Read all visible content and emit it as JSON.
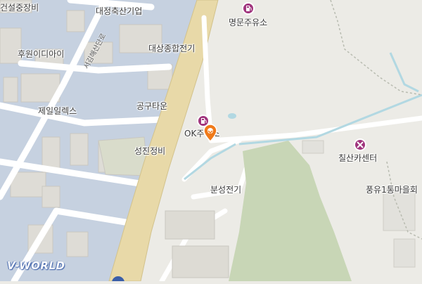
{
  "map": {
    "provider_logo": "V-WORLD",
    "colors": {
      "land": "#ecebe6",
      "industrial": "#c6d1e0",
      "building": "#e4e4e0",
      "main_road": "#e8d9a8",
      "road": "#ffffff",
      "park": "#c8d6b6",
      "stream": "#b2d8e2",
      "poi": "#a0347d",
      "marker": "#f07a1a"
    },
    "labels": [
      {
        "id": "daejeong",
        "text": "대정축산기업"
      },
      {
        "id": "daesang",
        "text": "대상종합전기"
      },
      {
        "id": "geonseol",
        "text": "건설중장비"
      },
      {
        "id": "huwon",
        "text": "후원이디아이"
      },
      {
        "id": "jeil",
        "text": "제일일렉스"
      },
      {
        "id": "gonggu",
        "text": "공구타운"
      },
      {
        "id": "seongjin",
        "text": "성진정비"
      },
      {
        "id": "bunseong",
        "text": "분성전기"
      },
      {
        "id": "pungyu",
        "text": "풍유1통마을회"
      }
    ],
    "road_label": "서김해산단로",
    "pois": [
      {
        "id": "myeongmun",
        "text": "명문주유소",
        "icon": "gas-station-icon"
      },
      {
        "id": "ok",
        "text": "OK주유소",
        "icon": "gas-station-icon"
      },
      {
        "id": "chilsan",
        "text": "칠산카센터",
        "icon": "car-repair-icon"
      }
    ],
    "selected_marker": "location-pin-icon"
  }
}
